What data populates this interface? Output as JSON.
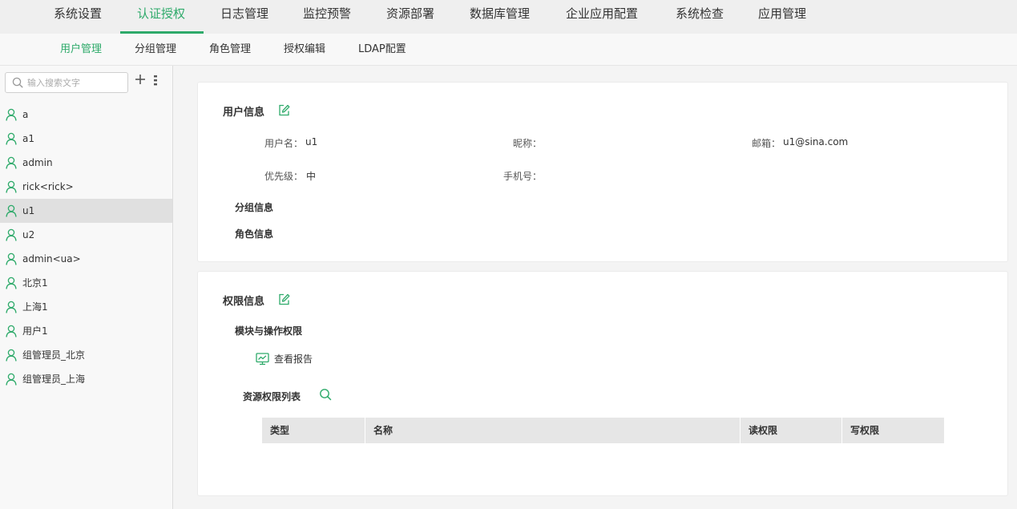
{
  "topnav": {
    "items": [
      "系统设置",
      "认证授权",
      "日志管理",
      "监控预警",
      "资源部署",
      "数据库管理",
      "企业应用配置",
      "系统检查",
      "应用管理"
    ],
    "active": "认证授权"
  },
  "subnav": {
    "items": [
      "用户管理",
      "分组管理",
      "角色管理",
      "授权编辑",
      "LDAP配置"
    ],
    "active": "用户管理"
  },
  "sidebar": {
    "search_placeholder": "输入搜索文字",
    "add_icon": "plus-icon",
    "more_icon": "more-vertical-icon",
    "users": [
      "a",
      "a1",
      "admin",
      "rick<rick>",
      "u1",
      "u2",
      "admin<ua>",
      "北京1",
      "上海1",
      "用户1",
      "组管理员_北京",
      "组管理员_上海"
    ],
    "selected": "u1"
  },
  "user_info": {
    "title": "用户信息",
    "username_label": "用户名：",
    "username": "u1",
    "nickname_label": "昵称：",
    "nickname": "",
    "email_label": "邮箱：",
    "email": "u1@sina.com",
    "priority_label": "优先级：",
    "priority": "中",
    "phone_label": "手机号：",
    "phone": "",
    "group_title": "分组信息",
    "role_title": "角色信息"
  },
  "permission_info": {
    "title": "权限信息",
    "module_title": "模块与操作权限",
    "report_label": "查看报告",
    "resource_title": "资源权限列表",
    "columns": [
      "类型",
      "名称",
      "读权限",
      "写权限"
    ]
  },
  "colors": {
    "accent": "#2eaa6a"
  }
}
